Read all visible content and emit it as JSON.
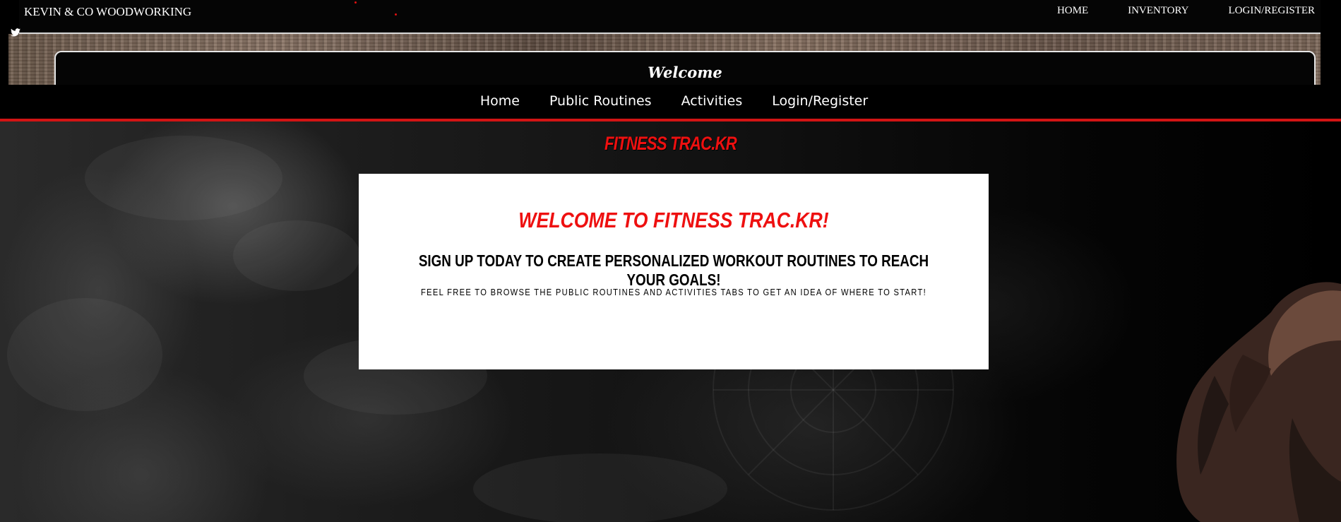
{
  "background_site": {
    "brand": "KEVIN & CO WOODWORKING",
    "nav_links": [
      "HOME",
      "INVENTORY",
      "LOGIN/REGISTER"
    ],
    "welcome_title": "Welcome",
    "side_icon": "twitter-icon"
  },
  "nav": {
    "links": [
      "Home",
      "Public Routines",
      "Activities",
      "Login/Register"
    ]
  },
  "logo": "FITNESS TRAC.KR",
  "welcome_card": {
    "title": "WELCOME TO FITNESS TRAC.KR!",
    "subtitle": "SIGN UP TODAY TO CREATE PERSONALIZED WORKOUT ROUTINES TO REACH YOUR GOALS!",
    "note": "FEEL FREE TO BROWSE THE PUBLIC ROUTINES AND ACTIVITIES TABS TO GET AN IDEA OF WHERE TO START!"
  },
  "colors": {
    "accent_red": "#ee1010",
    "nav_border_red": "#d21414",
    "background": "#000000",
    "card_background": "#ffffff"
  }
}
